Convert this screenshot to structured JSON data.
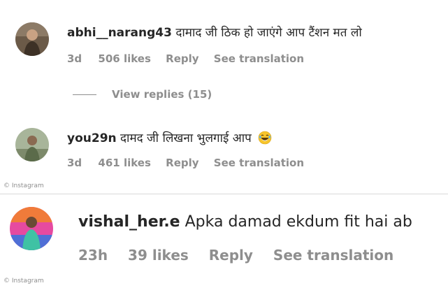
{
  "comments": [
    {
      "username": "abhi__narang43",
      "text": "दामाद जी ठिक हो जाएंगे आप टैंशन मत लो",
      "time": "3d",
      "likes": "506 likes",
      "reply": "Reply",
      "translate": "See translation"
    },
    {
      "username": "you29n",
      "text": "दामद जी लिखना भुलगाई आप",
      "emoji": "laughing-tears-emoji",
      "time": "3d",
      "likes": "461 likes",
      "reply": "Reply",
      "translate": "See translation"
    },
    {
      "username": "vishal_her.e",
      "text": "Apka damad ekdum fit hai ab",
      "time": "23h",
      "likes": "39 likes",
      "reply": "Reply",
      "translate": "See translation"
    }
  ],
  "view_replies": "View replies (15)",
  "watermark": "© Instagram",
  "colors": {
    "text": "#262626",
    "secondary": "#8e8e8e",
    "background": "#ffffff"
  }
}
